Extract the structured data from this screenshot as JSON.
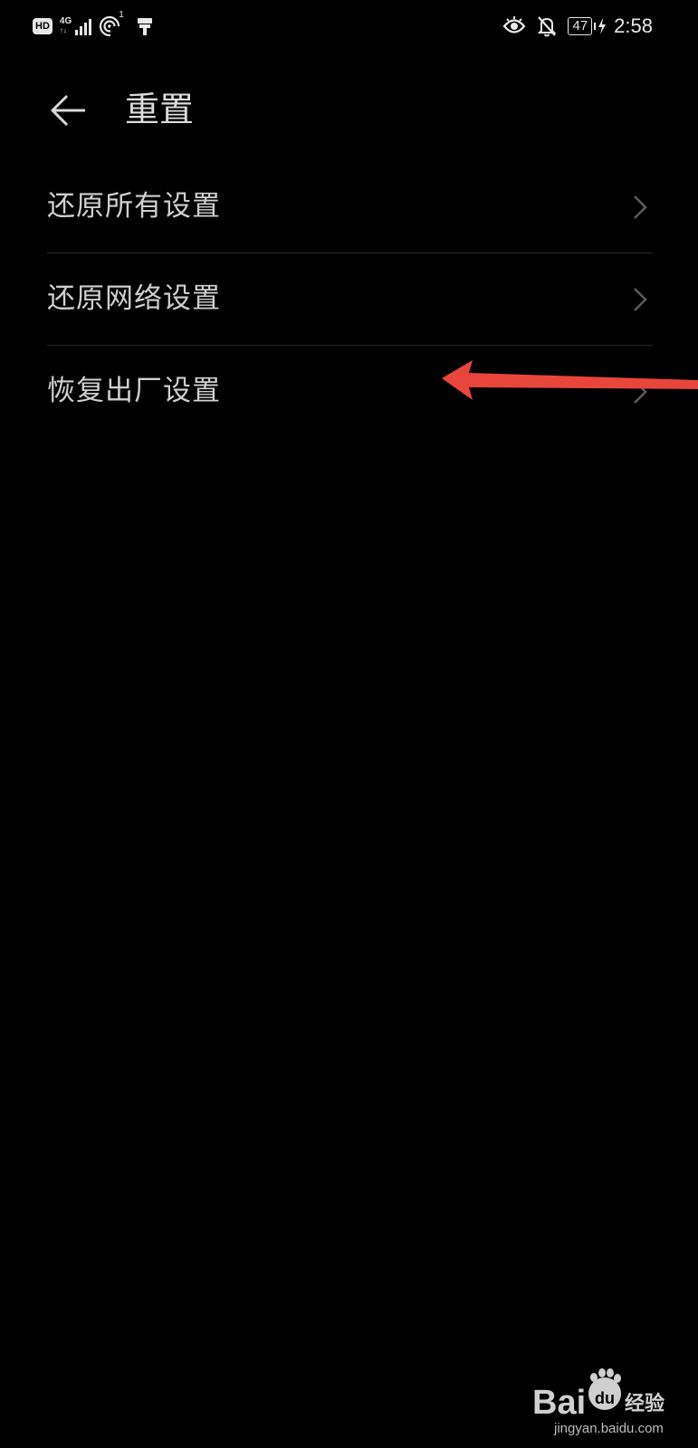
{
  "status_bar": {
    "hd": "HD",
    "network_type": "4G",
    "network_sub": "↑↓",
    "hotspot_count": "1",
    "battery_level": "47",
    "time": "2:58"
  },
  "header": {
    "title": "重置"
  },
  "settings": {
    "items": [
      {
        "label": "还原所有设置"
      },
      {
        "label": "还原网络设置"
      },
      {
        "label": "恢复出厂设置"
      }
    ]
  },
  "annotation": {
    "arrow_color": "#e8463b"
  },
  "watermark": {
    "brand": "Bai",
    "brand_du": "du",
    "suffix": "经验",
    "url": "jingyan.baidu.com"
  },
  "colors": {
    "background": "#000000",
    "text": "#cfcfcf",
    "divider": "#2a2a2a",
    "chevron": "#5a5a5a"
  }
}
